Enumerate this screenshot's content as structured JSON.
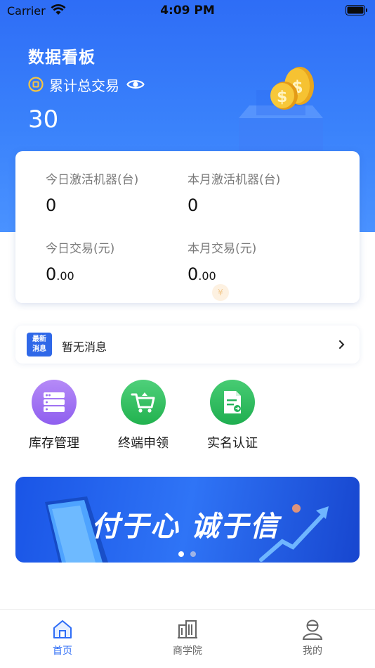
{
  "status_bar": {
    "carrier": "Carrier",
    "time": "4:09 PM"
  },
  "dashboard": {
    "title": "数据看板",
    "total_label": "累计总交易",
    "total_value": "30",
    "stats": [
      {
        "label": "今日激活机器(台)",
        "value": "0",
        "decimals": ""
      },
      {
        "label": "本月激活机器(台)",
        "value": "0",
        "decimals": ""
      },
      {
        "label": "今日交易(元)",
        "value": "0",
        "decimals": ".00"
      },
      {
        "label": "本月交易(元)",
        "value": "0",
        "decimals": ".00"
      }
    ]
  },
  "notice": {
    "badge_line1": "最新",
    "badge_line2": "消息",
    "text": "暂无消息"
  },
  "quick_actions": [
    {
      "label": "库存管理",
      "icon": "inventory-icon",
      "color": "#9b6ef0"
    },
    {
      "label": "终端申领",
      "icon": "shopping-cart-icon",
      "color": "#2dbb5e"
    },
    {
      "label": "实名认证",
      "icon": "document-icon",
      "color": "#22b35a"
    }
  ],
  "banner": {
    "text": "付于心 诚于信",
    "active_dot": 0,
    "dots": 2
  },
  "tab_bar": {
    "items": [
      {
        "label": "首页",
        "icon": "home-icon",
        "active": true
      },
      {
        "label": "商学院",
        "icon": "building-icon",
        "active": false
      },
      {
        "label": "我的",
        "icon": "user-icon",
        "active": false
      }
    ]
  },
  "colors": {
    "primary": "#2e6df6",
    "active_tab": "#2e6df6",
    "inactive_tab": "#666666"
  }
}
